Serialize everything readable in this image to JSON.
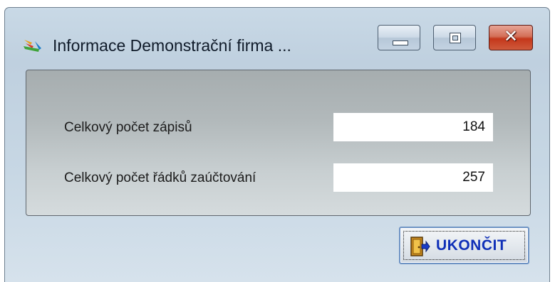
{
  "window": {
    "title": "Informace  Demonstrační firma ...",
    "controls": {
      "minimize": "minimize",
      "maximize": "maximize",
      "close": "close"
    }
  },
  "fields": [
    {
      "label": "Celkový počet zápisů",
      "value": "184"
    },
    {
      "label": "Celkový počet řádků zaúčtování",
      "value": "257"
    }
  ],
  "buttons": {
    "exit_label": "UKONČIT",
    "exit_icon": "exit-door-icon"
  },
  "colors": {
    "close_button": "#c4371b",
    "exit_label": "#1030b8",
    "panel": "#b2b9bb"
  }
}
